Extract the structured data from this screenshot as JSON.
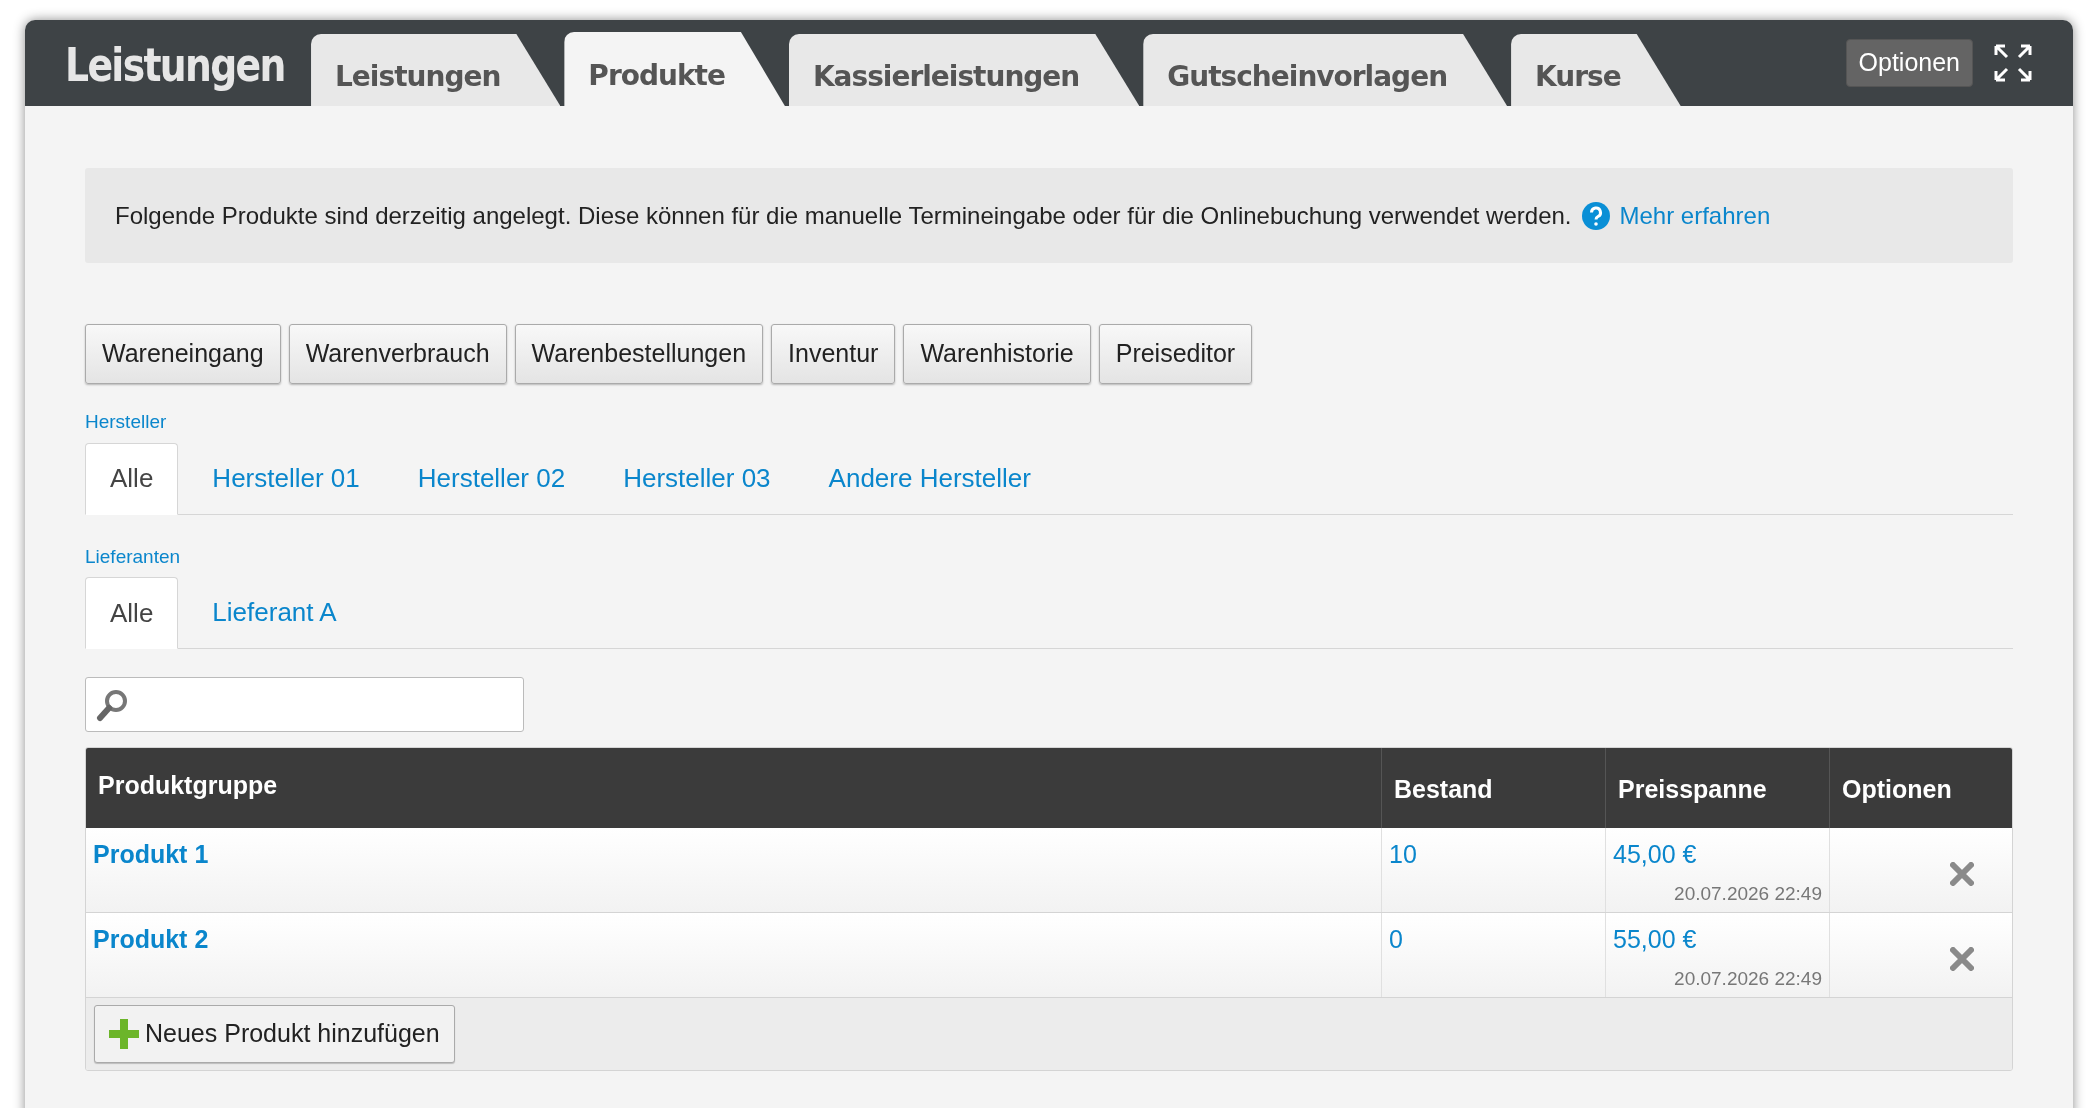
{
  "header": {
    "title": "Leistungen",
    "tabs": [
      {
        "label": "Leistungen",
        "selected": false
      },
      {
        "label": "Produkte",
        "selected": true
      },
      {
        "label": "Kassierleistungen",
        "selected": false
      },
      {
        "label": "Gutscheinvorlagen",
        "selected": false
      },
      {
        "label": "Kurse",
        "selected": false
      }
    ],
    "options_button": "Optionen"
  },
  "info": {
    "text": "Folgende Produkte sind derzeitig angelegt. Diese können für die manuelle Termineingabe oder für die Onlinebuchung verwendet werden.",
    "link": "Mehr erfahren"
  },
  "action_buttons": [
    "Wareneingang",
    "Warenverbrauch",
    "Warenbestellungen",
    "Inventur",
    "Warenhistorie",
    "Preiseditor"
  ],
  "filters": [
    {
      "label": "Hersteller",
      "tabs": [
        {
          "label": "Alle",
          "selected": true
        },
        {
          "label": "Hersteller 01",
          "selected": false
        },
        {
          "label": "Hersteller 02",
          "selected": false
        },
        {
          "label": "Hersteller 03",
          "selected": false
        },
        {
          "label": "Andere Hersteller",
          "selected": false
        }
      ]
    },
    {
      "label": "Lieferanten",
      "tabs": [
        {
          "label": "Alle",
          "selected": true
        },
        {
          "label": "Lieferant A",
          "selected": false
        }
      ]
    }
  ],
  "table": {
    "columns": [
      "Produktgruppe",
      "Bestand",
      "Preisspanne",
      "Optionen"
    ],
    "rows": [
      {
        "name": "Produkt 1",
        "stock": "10",
        "price": "45,00 €",
        "updated": "20.07.2026 22:49"
      },
      {
        "name": "Produkt 2",
        "stock": "0",
        "price": "55,00 €",
        "updated": "20.07.2026 22:49"
      }
    ],
    "add_button": "Neues Produkt hinzufügen"
  }
}
